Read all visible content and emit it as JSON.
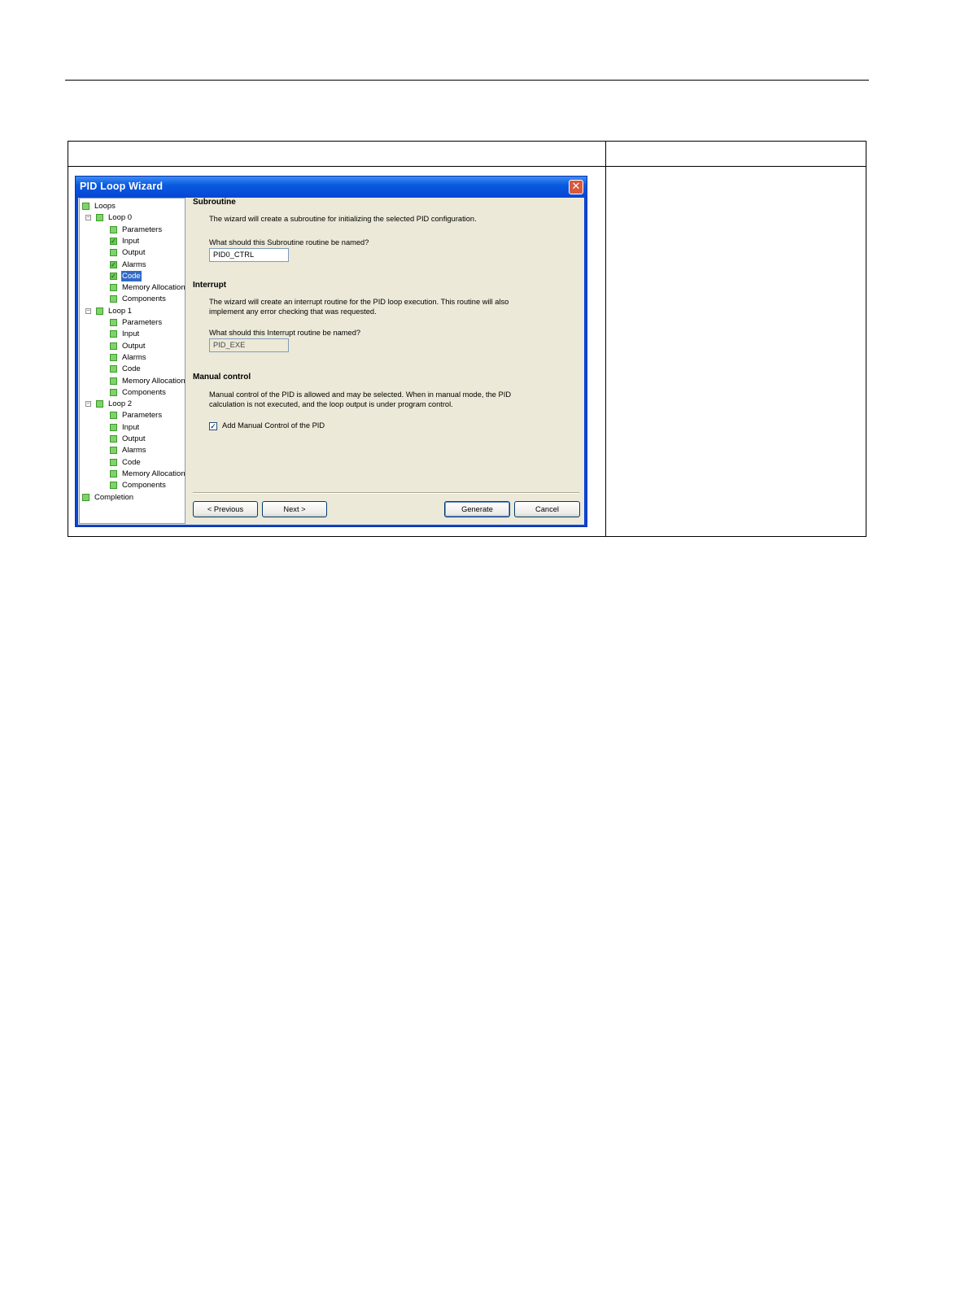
{
  "wizard": {
    "title": "PID Loop Wizard",
    "close_glyph": "✕",
    "tree": {
      "root": "Loops",
      "loops": [
        {
          "label": "Loop 0",
          "children": [
            {
              "label": "Parameters",
              "checked": false,
              "selected": false
            },
            {
              "label": "Input",
              "checked": true,
              "selected": false
            },
            {
              "label": "Output",
              "checked": false,
              "selected": false
            },
            {
              "label": "Alarms",
              "checked": true,
              "selected": false
            },
            {
              "label": "Code",
              "checked": true,
              "selected": true
            },
            {
              "label": "Memory Allocation",
              "checked": false,
              "selected": false
            },
            {
              "label": "Components",
              "checked": false,
              "selected": false
            }
          ]
        },
        {
          "label": "Loop 1",
          "children": [
            {
              "label": "Parameters",
              "checked": false,
              "selected": false
            },
            {
              "label": "Input",
              "checked": false,
              "selected": false
            },
            {
              "label": "Output",
              "checked": false,
              "selected": false
            },
            {
              "label": "Alarms",
              "checked": false,
              "selected": false
            },
            {
              "label": "Code",
              "checked": false,
              "selected": false
            },
            {
              "label": "Memory Allocation",
              "checked": false,
              "selected": false
            },
            {
              "label": "Components",
              "checked": false,
              "selected": false
            }
          ]
        },
        {
          "label": "Loop 2",
          "children": [
            {
              "label": "Parameters",
              "checked": false,
              "selected": false
            },
            {
              "label": "Input",
              "checked": false,
              "selected": false
            },
            {
              "label": "Output",
              "checked": false,
              "selected": false
            },
            {
              "label": "Alarms",
              "checked": false,
              "selected": false
            },
            {
              "label": "Code",
              "checked": false,
              "selected": false
            },
            {
              "label": "Memory Allocation",
              "checked": false,
              "selected": false
            },
            {
              "label": "Components",
              "checked": false,
              "selected": false
            }
          ]
        }
      ],
      "completion": "Completion"
    },
    "subroutine": {
      "title": "Subroutine",
      "description": "The wizard will create a subroutine for initializing the selected PID configuration.",
      "question": "What should this Subroutine routine be named?",
      "value": "PID0_CTRL"
    },
    "interrupt": {
      "title": "Interrupt",
      "description_line1": "The wizard will create an interrupt routine for the PID loop execution.  This routine will also",
      "description_line2": "implement any error checking that was requested.",
      "question": "What should this Interrupt routine be named?",
      "value": "PID_EXE"
    },
    "manual": {
      "title": "Manual control",
      "description_line1": "Manual control of the PID is allowed and may be selected.  When in manual mode, the PID",
      "description_line2": "calculation is not executed, and the loop output is under program control.",
      "checkbox_label": "Add Manual Control of the PID",
      "checked": true,
      "check_glyph": "✓"
    },
    "buttons": {
      "previous": "< Previous",
      "next": "Next >",
      "generate": "Generate",
      "cancel": "Cancel"
    }
  }
}
